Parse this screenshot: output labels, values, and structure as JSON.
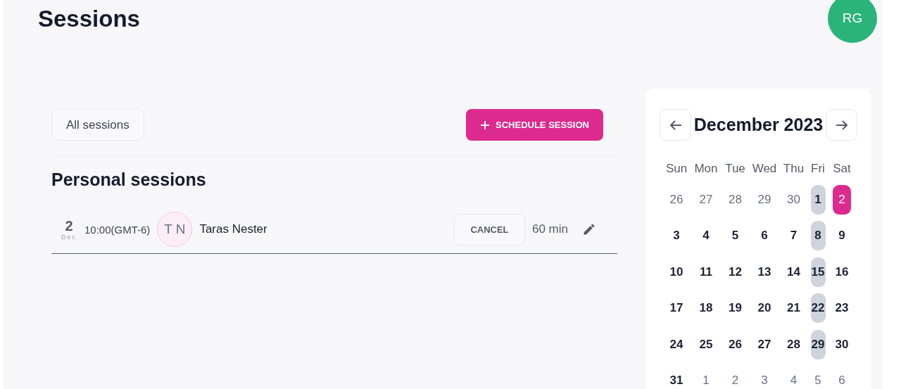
{
  "page": {
    "title": "Sessions"
  },
  "user": {
    "initials": "RG"
  },
  "toolbar": {
    "filter_button": "All sessions",
    "schedule_button": "SCHEDULE SESSION"
  },
  "section": {
    "title": "Personal sessions"
  },
  "sessions": [
    {
      "day": "2",
      "month": "Dec",
      "time": "10:00(GMT-6)",
      "initials": "T N",
      "name": "Taras Nester",
      "cancel_label": "CANCEL",
      "duration": "60 min"
    }
  ],
  "calendar": {
    "month": "December 2023",
    "weekdays": [
      "Sun",
      "Mon",
      "Tue",
      "Wed",
      "Thu",
      "Fri",
      "Sat"
    ],
    "weeks": [
      [
        {
          "label": "26",
          "muted": true,
          "marked": false,
          "selected": false
        },
        {
          "label": "27",
          "muted": true,
          "marked": false,
          "selected": false
        },
        {
          "label": "28",
          "muted": true,
          "marked": false,
          "selected": false
        },
        {
          "label": "29",
          "muted": true,
          "marked": false,
          "selected": false
        },
        {
          "label": "30",
          "muted": true,
          "marked": false,
          "selected": false
        },
        {
          "label": "1",
          "muted": false,
          "marked": true,
          "selected": false
        },
        {
          "label": "2",
          "muted": false,
          "marked": false,
          "selected": true
        }
      ],
      [
        {
          "label": "3",
          "muted": false,
          "marked": false,
          "selected": false
        },
        {
          "label": "4",
          "muted": false,
          "marked": false,
          "selected": false
        },
        {
          "label": "5",
          "muted": false,
          "marked": false,
          "selected": false
        },
        {
          "label": "6",
          "muted": false,
          "marked": false,
          "selected": false
        },
        {
          "label": "7",
          "muted": false,
          "marked": false,
          "selected": false
        },
        {
          "label": "8",
          "muted": false,
          "marked": true,
          "selected": false
        },
        {
          "label": "9",
          "muted": false,
          "marked": false,
          "selected": false
        }
      ],
      [
        {
          "label": "10",
          "muted": false,
          "marked": false,
          "selected": false
        },
        {
          "label": "11",
          "muted": false,
          "marked": false,
          "selected": false
        },
        {
          "label": "12",
          "muted": false,
          "marked": false,
          "selected": false
        },
        {
          "label": "13",
          "muted": false,
          "marked": false,
          "selected": false
        },
        {
          "label": "14",
          "muted": false,
          "marked": false,
          "selected": false
        },
        {
          "label": "15",
          "muted": false,
          "marked": true,
          "selected": false
        },
        {
          "label": "16",
          "muted": false,
          "marked": false,
          "selected": false
        }
      ],
      [
        {
          "label": "17",
          "muted": false,
          "marked": false,
          "selected": false
        },
        {
          "label": "18",
          "muted": false,
          "marked": false,
          "selected": false
        },
        {
          "label": "19",
          "muted": false,
          "marked": false,
          "selected": false
        },
        {
          "label": "20",
          "muted": false,
          "marked": false,
          "selected": false
        },
        {
          "label": "21",
          "muted": false,
          "marked": false,
          "selected": false
        },
        {
          "label": "22",
          "muted": false,
          "marked": true,
          "selected": false
        },
        {
          "label": "23",
          "muted": false,
          "marked": false,
          "selected": false
        }
      ],
      [
        {
          "label": "24",
          "muted": false,
          "marked": false,
          "selected": false
        },
        {
          "label": "25",
          "muted": false,
          "marked": false,
          "selected": false
        },
        {
          "label": "26",
          "muted": false,
          "marked": false,
          "selected": false
        },
        {
          "label": "27",
          "muted": false,
          "marked": false,
          "selected": false
        },
        {
          "label": "28",
          "muted": false,
          "marked": false,
          "selected": false
        },
        {
          "label": "29",
          "muted": false,
          "marked": true,
          "selected": false
        },
        {
          "label": "30",
          "muted": false,
          "marked": false,
          "selected": false
        }
      ],
      [
        {
          "label": "31",
          "muted": false,
          "marked": false,
          "selected": false
        },
        {
          "label": "1",
          "muted": true,
          "marked": false,
          "selected": false
        },
        {
          "label": "2",
          "muted": true,
          "marked": false,
          "selected": false
        },
        {
          "label": "3",
          "muted": true,
          "marked": false,
          "selected": false
        },
        {
          "label": "4",
          "muted": true,
          "marked": false,
          "selected": false
        },
        {
          "label": "5",
          "muted": true,
          "marked": false,
          "selected": false
        },
        {
          "label": "6",
          "muted": true,
          "marked": false,
          "selected": false
        }
      ]
    ]
  }
}
